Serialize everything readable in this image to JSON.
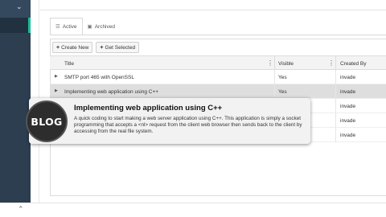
{
  "tabs": [
    {
      "label": "Active",
      "icon": "list-icon",
      "active": true
    },
    {
      "label": "Archived",
      "icon": "archive-icon",
      "active": false
    }
  ],
  "toolbar": {
    "create_label": "Create New",
    "get_selected_label": "Get Selected"
  },
  "grid": {
    "columns": [
      "Title",
      "Visible",
      "Created By"
    ],
    "rows": [
      {
        "title": "SMTP port 465 with OpenSSL",
        "visible": "Yes",
        "created_by": "invade",
        "selected": false
      },
      {
        "title": "Implementing web application using C++",
        "visible": "Yes",
        "created_by": "invade",
        "selected": true
      },
      {
        "title": "",
        "visible": "",
        "created_by": "invade",
        "selected": false
      },
      {
        "title": "",
        "visible": "",
        "created_by": "invade",
        "selected": false
      },
      {
        "title": "",
        "visible": "",
        "created_by": "invade",
        "selected": false
      }
    ]
  },
  "card": {
    "badge": "BLOG",
    "title": "Implementing web application using C++",
    "description": "A quick coding to start making a web server application using C++. This application is simply a socket programming that accepts a <nl> request from the client web browser then sends back to the client by accessing from the real file system."
  },
  "colors": {
    "sidebar": "#2c3e50",
    "sidebar_accent": "#1abc9c",
    "selected_row": "#dedede"
  }
}
